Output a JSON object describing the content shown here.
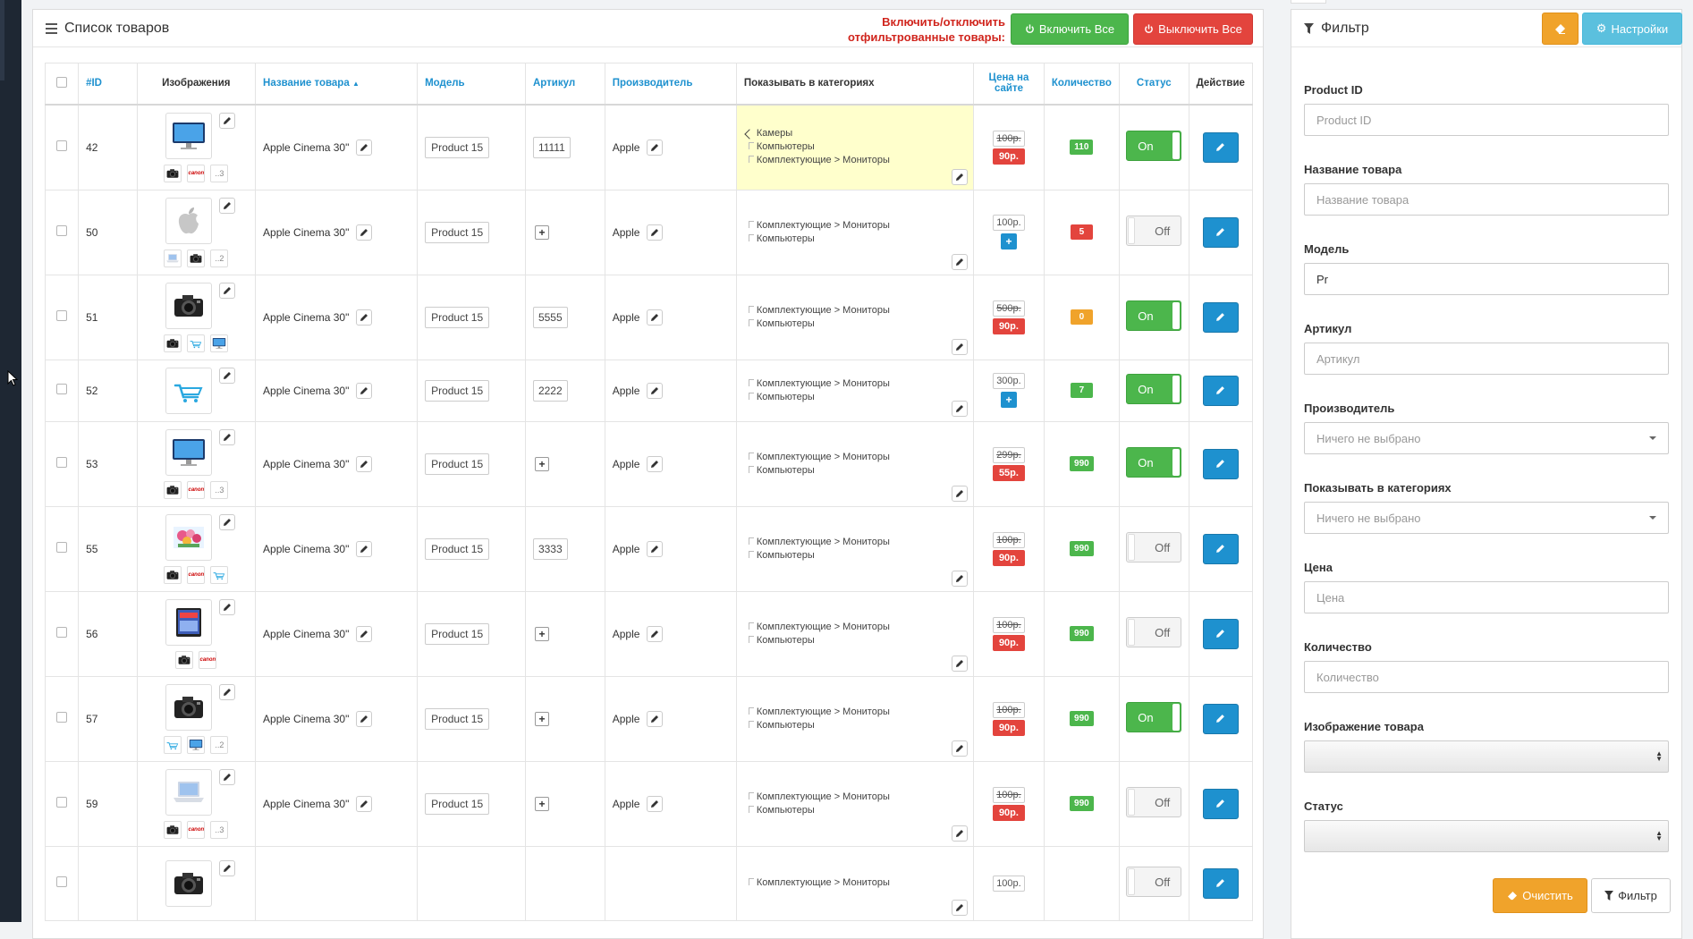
{
  "panel": {
    "title": "Список товаров",
    "toggle_note_line1": "Включить/отключить",
    "toggle_note_line2": "отфильтрованные товары:",
    "enable_all": "Включить Все",
    "disable_all": "Выключить Все"
  },
  "table": {
    "headers": {
      "id": "#ID",
      "images": "Изображения",
      "name": "Название товара",
      "model": "Модель",
      "sku": "Артикул",
      "manufacturer": "Производитель",
      "categories": "Показывать в категориях",
      "price_line1": "Цена на",
      "price_line2": "сайте",
      "quantity": "Количество",
      "status": "Статус",
      "action": "Действие"
    },
    "rows": [
      {
        "id": "42",
        "thumb": "monitor",
        "small": [
          "camera",
          "canon",
          "..3"
        ],
        "name": "Apple Cinema 30\"",
        "model": "Product 15",
        "sku": "11111",
        "manufacturer": "Apple",
        "categories": [
          "Камеры",
          "Компьютеры",
          "Комплектующие > Мониторы"
        ],
        "cat_highlight": true,
        "price_old": "100р.",
        "price_new": "90р.",
        "qty": "110",
        "qty_color": "green",
        "status": "On"
      },
      {
        "id": "50",
        "thumb": "apple",
        "small": [
          "laptop",
          "camera",
          "..2"
        ],
        "name": "Apple Cinema 30\"",
        "model": "Product 15",
        "sku": "",
        "manufacturer": "Apple",
        "categories": [
          "Комплектующие  >  Мониторы",
          "Компьютеры"
        ],
        "cat_highlight": false,
        "price_old": "100р.",
        "price_new": "",
        "qty": "5",
        "qty_color": "red",
        "status": "Off"
      },
      {
        "id": "51",
        "thumb": "camera",
        "small": [
          "camera",
          "cart",
          "monitor"
        ],
        "name": "Apple Cinema 30\"",
        "model": "Product 15",
        "sku": "5555",
        "manufacturer": "Apple",
        "categories": [
          "Комплектующие  >  Мониторы",
          "Компьютеры"
        ],
        "cat_highlight": false,
        "price_old": "500р.",
        "price_new": "90р.",
        "qty": "0",
        "qty_color": "orange",
        "status": "On"
      },
      {
        "id": "52",
        "thumb": "cart",
        "small": [],
        "name": "Apple Cinema 30\"",
        "model": "Product 15",
        "sku": "2222",
        "manufacturer": "Apple",
        "categories": [
          "Комплектующие  >  Мониторы",
          "Компьютеры"
        ],
        "cat_highlight": false,
        "price_old": "300р.",
        "price_new": "",
        "qty": "7",
        "qty_color": "green",
        "status": "On"
      },
      {
        "id": "53",
        "thumb": "monitor",
        "small": [
          "camera",
          "canon",
          "..3"
        ],
        "name": "Apple Cinema 30\"",
        "model": "Product 15",
        "sku": "",
        "manufacturer": "Apple",
        "categories": [
          "Комплектующие  >  Мониторы",
          "Компьютеры"
        ],
        "cat_highlight": false,
        "price_old": "299р.",
        "price_new": "55р.",
        "qty": "990",
        "qty_color": "green",
        "status": "On"
      },
      {
        "id": "55",
        "thumb": "flowers",
        "small": [
          "camera",
          "canon",
          "cart"
        ],
        "name": "Apple Cinema 30\"",
        "model": "Product 15",
        "sku": "3333",
        "manufacturer": "Apple",
        "categories": [
          "Комплектующие  >  Мониторы",
          "Компьютеры"
        ],
        "cat_highlight": false,
        "price_old": "100р.",
        "price_new": "90р.",
        "qty": "990",
        "qty_color": "green",
        "status": "Off"
      },
      {
        "id": "56",
        "thumb": "tablet",
        "small": [
          "camera",
          "canon"
        ],
        "name": "Apple Cinema 30\"",
        "model": "Product 15",
        "sku": "",
        "manufacturer": "Apple",
        "categories": [
          "Комплектующие  >  Мониторы",
          "Компьютеры"
        ],
        "cat_highlight": false,
        "price_old": "100р.",
        "price_new": "90р.",
        "qty": "990",
        "qty_color": "green",
        "status": "Off"
      },
      {
        "id": "57",
        "thumb": "camera",
        "small": [
          "cart",
          "monitor",
          "..2"
        ],
        "name": "Apple Cinema 30\"",
        "model": "Product 15",
        "sku": "",
        "manufacturer": "Apple",
        "categories": [
          "Комплектующие  >  Мониторы",
          "Компьютеры"
        ],
        "cat_highlight": false,
        "price_old": "100р.",
        "price_new": "90р.",
        "qty": "990",
        "qty_color": "green",
        "status": "On"
      },
      {
        "id": "59",
        "thumb": "laptop",
        "small": [
          "camera",
          "canon",
          "..3"
        ],
        "name": "Apple Cinema 30\"",
        "model": "Product 15",
        "sku": "",
        "manufacturer": "Apple",
        "categories": [
          "Комплектующие  >  Мониторы",
          "Компьютеры"
        ],
        "cat_highlight": false,
        "price_old": "100р.",
        "price_new": "90р.",
        "qty": "990",
        "qty_color": "green",
        "status": "Off"
      },
      {
        "id": "",
        "thumb": "camera",
        "small": [],
        "name": "",
        "model": "",
        "sku": "",
        "manufacturer": "",
        "categories": [
          "Комплектующие  >  Мониторы"
        ],
        "cat_highlight": false,
        "price_old": "100р.",
        "price_new": "",
        "qty": "",
        "qty_color": "green",
        "status": "Off"
      }
    ]
  },
  "filter": {
    "title": "Фильтр",
    "settings": "Настройки",
    "fields": [
      {
        "label": "Product ID",
        "type": "text",
        "value": "",
        "placeholder": "Product ID"
      },
      {
        "label": "Название товара",
        "type": "text",
        "value": "",
        "placeholder": "Название товара"
      },
      {
        "label": "Модель",
        "type": "text",
        "value": "Pr",
        "placeholder": ""
      },
      {
        "label": "Артикул",
        "type": "text",
        "value": "",
        "placeholder": "Артикул"
      },
      {
        "label": "Производитель",
        "type": "select",
        "value": "Ничего не выбрано",
        "placeholder": ""
      },
      {
        "label": "Показывать в категориях",
        "type": "select",
        "value": "Ничего не выбрано",
        "placeholder": ""
      },
      {
        "label": "Цена",
        "type": "text",
        "value": "",
        "placeholder": "Цена"
      },
      {
        "label": "Количество",
        "type": "text",
        "value": "",
        "placeholder": "Количество"
      },
      {
        "label": "Изображение товара",
        "type": "native",
        "value": "",
        "placeholder": ""
      },
      {
        "label": "Статус",
        "type": "native",
        "value": "",
        "placeholder": ""
      }
    ],
    "clear": "Очистить",
    "apply": "Фильтр"
  }
}
